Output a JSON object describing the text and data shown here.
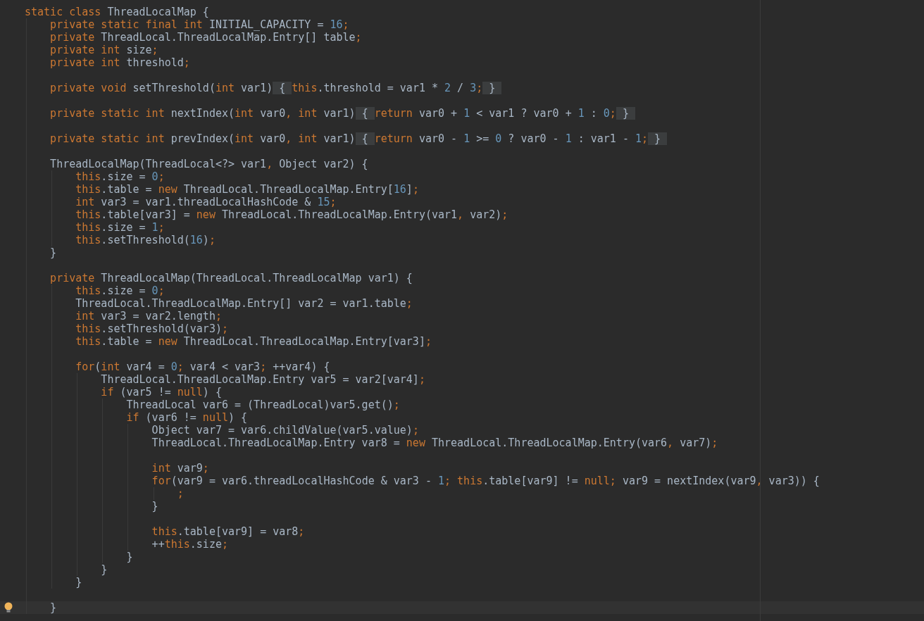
{
  "editor": {
    "lines": [
      {
        "kind": "code",
        "current": false,
        "tokens": [
          {
            "text": "static class",
            "kind": "k"
          },
          {
            "text": " ThreadLocalMap {",
            "kind": "p"
          }
        ]
      },
      {
        "kind": "code",
        "current": false,
        "tokens": [
          {
            "text": "    private static final int",
            "kind": "k"
          },
          {
            "text": " INITIAL_CAPACITY = ",
            "kind": "p"
          },
          {
            "text": "16",
            "kind": "n"
          },
          {
            "text": ";",
            "kind": "k"
          }
        ]
      },
      {
        "kind": "code",
        "current": false,
        "tokens": [
          {
            "text": "    private",
            "kind": "k"
          },
          {
            "text": " ThreadLocal.ThreadLocalMap.Entry[] table",
            "kind": "p"
          },
          {
            "text": ";",
            "kind": "k"
          }
        ]
      },
      {
        "kind": "code",
        "current": false,
        "tokens": [
          {
            "text": "    private int",
            "kind": "k"
          },
          {
            "text": " size",
            "kind": "p"
          },
          {
            "text": ";",
            "kind": "k"
          }
        ]
      },
      {
        "kind": "code",
        "current": false,
        "tokens": [
          {
            "text": "    private int",
            "kind": "k"
          },
          {
            "text": " threshold",
            "kind": "p"
          },
          {
            "text": ";",
            "kind": "k"
          }
        ]
      },
      {
        "kind": "blank",
        "current": false
      },
      {
        "kind": "code",
        "current": false,
        "tokens": [
          {
            "text": "    private void",
            "kind": "k"
          },
          {
            "text": " setThreshold(",
            "kind": "p"
          },
          {
            "text": "int",
            "kind": "k"
          },
          {
            "text": " var1)",
            "kind": "p"
          },
          {
            "text": " { ",
            "kind": "f"
          },
          {
            "text": "this",
            "kind": "k"
          },
          {
            "text": ".threshold = var1 * ",
            "kind": "p"
          },
          {
            "text": "2",
            "kind": "n"
          },
          {
            "text": " / ",
            "kind": "p"
          },
          {
            "text": "3",
            "kind": "n"
          },
          {
            "text": ";",
            "kind": "k"
          },
          {
            "text": " } ",
            "kind": "f"
          }
        ]
      },
      {
        "kind": "blank",
        "current": false
      },
      {
        "kind": "code",
        "current": false,
        "tokens": [
          {
            "text": "    private static int",
            "kind": "k"
          },
          {
            "text": " nextIndex(",
            "kind": "p"
          },
          {
            "text": "int",
            "kind": "k"
          },
          {
            "text": " var0",
            "kind": "p"
          },
          {
            "text": ", int",
            "kind": "k"
          },
          {
            "text": " var1)",
            "kind": "p"
          },
          {
            "text": " { ",
            "kind": "f"
          },
          {
            "text": "return",
            "kind": "k"
          },
          {
            "text": " var0 + ",
            "kind": "p"
          },
          {
            "text": "1",
            "kind": "n"
          },
          {
            "text": " < var1 ? var0 + ",
            "kind": "p"
          },
          {
            "text": "1",
            "kind": "n"
          },
          {
            "text": " : ",
            "kind": "p"
          },
          {
            "text": "0",
            "kind": "n"
          },
          {
            "text": ";",
            "kind": "k"
          },
          {
            "text": " } ",
            "kind": "f"
          }
        ]
      },
      {
        "kind": "blank",
        "current": false
      },
      {
        "kind": "code",
        "current": false,
        "tokens": [
          {
            "text": "    private static int",
            "kind": "k"
          },
          {
            "text": " prevIndex(",
            "kind": "p"
          },
          {
            "text": "int",
            "kind": "k"
          },
          {
            "text": " var0",
            "kind": "p"
          },
          {
            "text": ", int",
            "kind": "k"
          },
          {
            "text": " var1)",
            "kind": "p"
          },
          {
            "text": " { ",
            "kind": "f"
          },
          {
            "text": "return",
            "kind": "k"
          },
          {
            "text": " var0 - ",
            "kind": "p"
          },
          {
            "text": "1",
            "kind": "n"
          },
          {
            "text": " >= ",
            "kind": "p"
          },
          {
            "text": "0",
            "kind": "n"
          },
          {
            "text": " ? var0 - ",
            "kind": "p"
          },
          {
            "text": "1",
            "kind": "n"
          },
          {
            "text": " : var1 - ",
            "kind": "p"
          },
          {
            "text": "1",
            "kind": "n"
          },
          {
            "text": ";",
            "kind": "k"
          },
          {
            "text": " } ",
            "kind": "f"
          }
        ]
      },
      {
        "kind": "blank",
        "current": false
      },
      {
        "kind": "code",
        "current": false,
        "tokens": [
          {
            "text": "    ThreadLocalMap(ThreadLocal<?> var1",
            "kind": "p"
          },
          {
            "text": ",",
            "kind": "k"
          },
          {
            "text": " Object var2) {",
            "kind": "p"
          }
        ]
      },
      {
        "kind": "code",
        "current": false,
        "tokens": [
          {
            "text": "        this",
            "kind": "k"
          },
          {
            "text": ".size = ",
            "kind": "p"
          },
          {
            "text": "0",
            "kind": "n"
          },
          {
            "text": ";",
            "kind": "k"
          }
        ]
      },
      {
        "kind": "code",
        "current": false,
        "tokens": [
          {
            "text": "        this",
            "kind": "k"
          },
          {
            "text": ".table = ",
            "kind": "p"
          },
          {
            "text": "new",
            "kind": "k"
          },
          {
            "text": " ThreadLocal.ThreadLocalMap.Entry[",
            "kind": "p"
          },
          {
            "text": "16",
            "kind": "n"
          },
          {
            "text": "]",
            "kind": "p"
          },
          {
            "text": ";",
            "kind": "k"
          }
        ]
      },
      {
        "kind": "code",
        "current": false,
        "tokens": [
          {
            "text": "        int",
            "kind": "k"
          },
          {
            "text": " var3 = var1.threadLocalHashCode & ",
            "kind": "p"
          },
          {
            "text": "15",
            "kind": "n"
          },
          {
            "text": ";",
            "kind": "k"
          }
        ]
      },
      {
        "kind": "code",
        "current": false,
        "tokens": [
          {
            "text": "        this",
            "kind": "k"
          },
          {
            "text": ".table[var3] = ",
            "kind": "p"
          },
          {
            "text": "new",
            "kind": "k"
          },
          {
            "text": " ThreadLocal.ThreadLocalMap.Entry(var1",
            "kind": "p"
          },
          {
            "text": ",",
            "kind": "k"
          },
          {
            "text": " var2)",
            "kind": "p"
          },
          {
            "text": ";",
            "kind": "k"
          }
        ]
      },
      {
        "kind": "code",
        "current": false,
        "tokens": [
          {
            "text": "        this",
            "kind": "k"
          },
          {
            "text": ".size = ",
            "kind": "p"
          },
          {
            "text": "1",
            "kind": "n"
          },
          {
            "text": ";",
            "kind": "k"
          }
        ]
      },
      {
        "kind": "code",
        "current": false,
        "tokens": [
          {
            "text": "        this",
            "kind": "k"
          },
          {
            "text": ".setThreshold(",
            "kind": "p"
          },
          {
            "text": "16",
            "kind": "n"
          },
          {
            "text": ")",
            "kind": "p"
          },
          {
            "text": ";",
            "kind": "k"
          }
        ]
      },
      {
        "kind": "code",
        "current": false,
        "tokens": [
          {
            "text": "    }",
            "kind": "p"
          }
        ]
      },
      {
        "kind": "blank",
        "current": false
      },
      {
        "kind": "code",
        "current": false,
        "tokens": [
          {
            "text": "    private",
            "kind": "k"
          },
          {
            "text": " ThreadLocalMap(ThreadLocal.ThreadLocalMap var1) {",
            "kind": "p"
          }
        ]
      },
      {
        "kind": "code",
        "current": false,
        "tokens": [
          {
            "text": "        this",
            "kind": "k"
          },
          {
            "text": ".size = ",
            "kind": "p"
          },
          {
            "text": "0",
            "kind": "n"
          },
          {
            "text": ";",
            "kind": "k"
          }
        ]
      },
      {
        "kind": "code",
        "current": false,
        "tokens": [
          {
            "text": "        ThreadLocal.ThreadLocalMap.Entry[] var2 = var1.table",
            "kind": "p"
          },
          {
            "text": ";",
            "kind": "k"
          }
        ]
      },
      {
        "kind": "code",
        "current": false,
        "tokens": [
          {
            "text": "        int",
            "kind": "k"
          },
          {
            "text": " var3 = var2.length",
            "kind": "p"
          },
          {
            "text": ";",
            "kind": "k"
          }
        ]
      },
      {
        "kind": "code",
        "current": false,
        "tokens": [
          {
            "text": "        this",
            "kind": "k"
          },
          {
            "text": ".setThreshold(var3)",
            "kind": "p"
          },
          {
            "text": ";",
            "kind": "k"
          }
        ]
      },
      {
        "kind": "code",
        "current": false,
        "tokens": [
          {
            "text": "        this",
            "kind": "k"
          },
          {
            "text": ".table = ",
            "kind": "p"
          },
          {
            "text": "new",
            "kind": "k"
          },
          {
            "text": " ThreadLocal.ThreadLocalMap.Entry[var3]",
            "kind": "p"
          },
          {
            "text": ";",
            "kind": "k"
          }
        ]
      },
      {
        "kind": "blank",
        "current": false
      },
      {
        "kind": "code",
        "current": false,
        "tokens": [
          {
            "text": "        for",
            "kind": "k"
          },
          {
            "text": "(",
            "kind": "p"
          },
          {
            "text": "int",
            "kind": "k"
          },
          {
            "text": " var4 = ",
            "kind": "p"
          },
          {
            "text": "0",
            "kind": "n"
          },
          {
            "text": ";",
            "kind": "k"
          },
          {
            "text": " var4 < var3",
            "kind": "p"
          },
          {
            "text": ";",
            "kind": "k"
          },
          {
            "text": " ++var4) {",
            "kind": "p"
          }
        ]
      },
      {
        "kind": "code",
        "current": false,
        "tokens": [
          {
            "text": "            ThreadLocal.ThreadLocalMap.Entry var5 = var2[var4]",
            "kind": "p"
          },
          {
            "text": ";",
            "kind": "k"
          }
        ]
      },
      {
        "kind": "code",
        "current": false,
        "tokens": [
          {
            "text": "            if",
            "kind": "k"
          },
          {
            "text": " (var5 != ",
            "kind": "p"
          },
          {
            "text": "null",
            "kind": "k"
          },
          {
            "text": ") {",
            "kind": "p"
          }
        ]
      },
      {
        "kind": "code",
        "current": false,
        "tokens": [
          {
            "text": "                ThreadLocal var6 = (ThreadLocal)var5.get()",
            "kind": "p"
          },
          {
            "text": ";",
            "kind": "k"
          }
        ]
      },
      {
        "kind": "code",
        "current": false,
        "tokens": [
          {
            "text": "                if",
            "kind": "k"
          },
          {
            "text": " (var6 != ",
            "kind": "p"
          },
          {
            "text": "null",
            "kind": "k"
          },
          {
            "text": ") {",
            "kind": "p"
          }
        ]
      },
      {
        "kind": "code",
        "current": false,
        "tokens": [
          {
            "text": "                    Object var7 = var6.childValue(var5.value)",
            "kind": "p"
          },
          {
            "text": ";",
            "kind": "k"
          }
        ]
      },
      {
        "kind": "code",
        "current": false,
        "tokens": [
          {
            "text": "                    ThreadLocal.ThreadLocalMap.Entry var8 = ",
            "kind": "p"
          },
          {
            "text": "new",
            "kind": "k"
          },
          {
            "text": " ThreadLocal.ThreadLocalMap.Entry(var6",
            "kind": "p"
          },
          {
            "text": ",",
            "kind": "k"
          },
          {
            "text": " var7)",
            "kind": "p"
          },
          {
            "text": ";",
            "kind": "k"
          }
        ]
      },
      {
        "kind": "blank",
        "current": false
      },
      {
        "kind": "code",
        "current": false,
        "tokens": [
          {
            "text": "                    int",
            "kind": "k"
          },
          {
            "text": " var9",
            "kind": "p"
          },
          {
            "text": ";",
            "kind": "k"
          }
        ]
      },
      {
        "kind": "code",
        "current": false,
        "tokens": [
          {
            "text": "                    for",
            "kind": "k"
          },
          {
            "text": "(var9 = var6.threadLocalHashCode & var3 - ",
            "kind": "p"
          },
          {
            "text": "1",
            "kind": "n"
          },
          {
            "text": "; this",
            "kind": "k"
          },
          {
            "text": ".table[var9] != ",
            "kind": "p"
          },
          {
            "text": "null;",
            "kind": "k"
          },
          {
            "text": " var9 = nextIndex(var9",
            "kind": "p"
          },
          {
            "text": ",",
            "kind": "k"
          },
          {
            "text": " var3)) {",
            "kind": "p"
          }
        ]
      },
      {
        "kind": "code",
        "current": false,
        "tokens": [
          {
            "text": "                        ;",
            "kind": "k"
          }
        ]
      },
      {
        "kind": "code",
        "current": false,
        "tokens": [
          {
            "text": "                    }",
            "kind": "p"
          }
        ]
      },
      {
        "kind": "blank",
        "current": false
      },
      {
        "kind": "code",
        "current": false,
        "tokens": [
          {
            "text": "                    this",
            "kind": "k"
          },
          {
            "text": ".table[var9] = var8",
            "kind": "p"
          },
          {
            "text": ";",
            "kind": "k"
          }
        ]
      },
      {
        "kind": "code",
        "current": false,
        "tokens": [
          {
            "text": "                    ++",
            "kind": "p"
          },
          {
            "text": "this",
            "kind": "k"
          },
          {
            "text": ".size",
            "kind": "p"
          },
          {
            "text": ";",
            "kind": "k"
          }
        ]
      },
      {
        "kind": "code",
        "current": false,
        "tokens": [
          {
            "text": "                }",
            "kind": "p"
          }
        ]
      },
      {
        "kind": "code",
        "current": false,
        "tokens": [
          {
            "text": "            }",
            "kind": "p"
          }
        ]
      },
      {
        "kind": "code",
        "current": false,
        "tokens": [
          {
            "text": "        }",
            "kind": "p"
          }
        ]
      },
      {
        "kind": "blank",
        "current": false
      },
      {
        "kind": "code",
        "current": true,
        "tokens": [
          {
            "text": "    }",
            "kind": "p"
          }
        ]
      }
    ]
  }
}
